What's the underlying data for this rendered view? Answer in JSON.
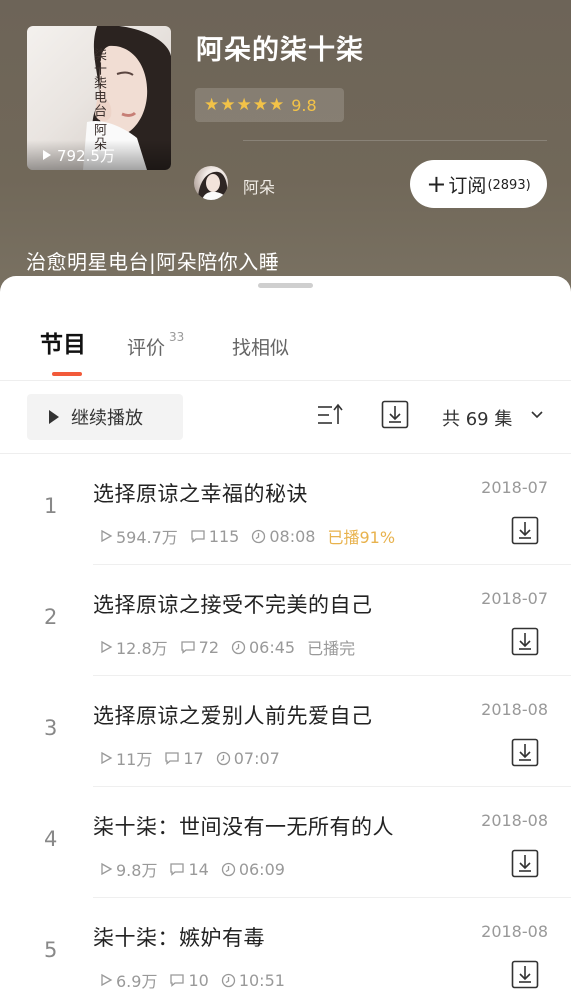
{
  "album": {
    "title": "阿朵的柒十柒",
    "cover_text": "柒十柒电台 阿朵",
    "plays": "792.5万",
    "stars": "★★★★★",
    "score": "9.8",
    "host": "阿朵",
    "subscribe_label": "订阅",
    "subscribe_count": "(2893)",
    "description": "治愈明星电台|阿朵陪你入睡"
  },
  "tabs": [
    {
      "label": "节目",
      "badge": ""
    },
    {
      "label": "评价",
      "badge": "33"
    },
    {
      "label": "找相似",
      "badge": ""
    }
  ],
  "toolbar": {
    "continue_label": "继续播放",
    "count_label": "共 69 集"
  },
  "episodes": [
    {
      "num": "1",
      "title": "选择原谅之幸福的秘诀",
      "date": "2018-07",
      "plays": "594.7万",
      "comments": "115",
      "duration": "08:08",
      "progress": "已播91%",
      "progress_color": "#e8b24d"
    },
    {
      "num": "2",
      "title": "选择原谅之接受不完美的自己",
      "date": "2018-07",
      "plays": "12.8万",
      "comments": "72",
      "duration": "06:45",
      "progress": "已播完",
      "progress_color": "#999999"
    },
    {
      "num": "3",
      "title": "选择原谅之爱别人前先爱自己",
      "date": "2018-08",
      "plays": "11万",
      "comments": "17",
      "duration": "07:07",
      "progress": "",
      "progress_color": "#999999"
    },
    {
      "num": "4",
      "title": "柒十柒：世间没有一无所有的人",
      "date": "2018-08",
      "plays": "9.8万",
      "comments": "14",
      "duration": "06:09",
      "progress": "",
      "progress_color": "#999999"
    },
    {
      "num": "5",
      "title": "柒十柒：嫉妒有毒",
      "date": "2018-08",
      "plays": "6.9万",
      "comments": "10",
      "duration": "10:51",
      "progress": "",
      "progress_color": "#999999"
    }
  ],
  "icons": {
    "play": "play-icon",
    "comment": "comment-icon",
    "clock": "clock-icon",
    "download": "download-icon",
    "sort": "sort-icon",
    "chevron": "chevron-down-icon"
  },
  "colors": {
    "accent": "#f25a3a",
    "star": "#f2c248",
    "progress_orange": "#e8b24d",
    "header_bg": "#6f6659"
  }
}
